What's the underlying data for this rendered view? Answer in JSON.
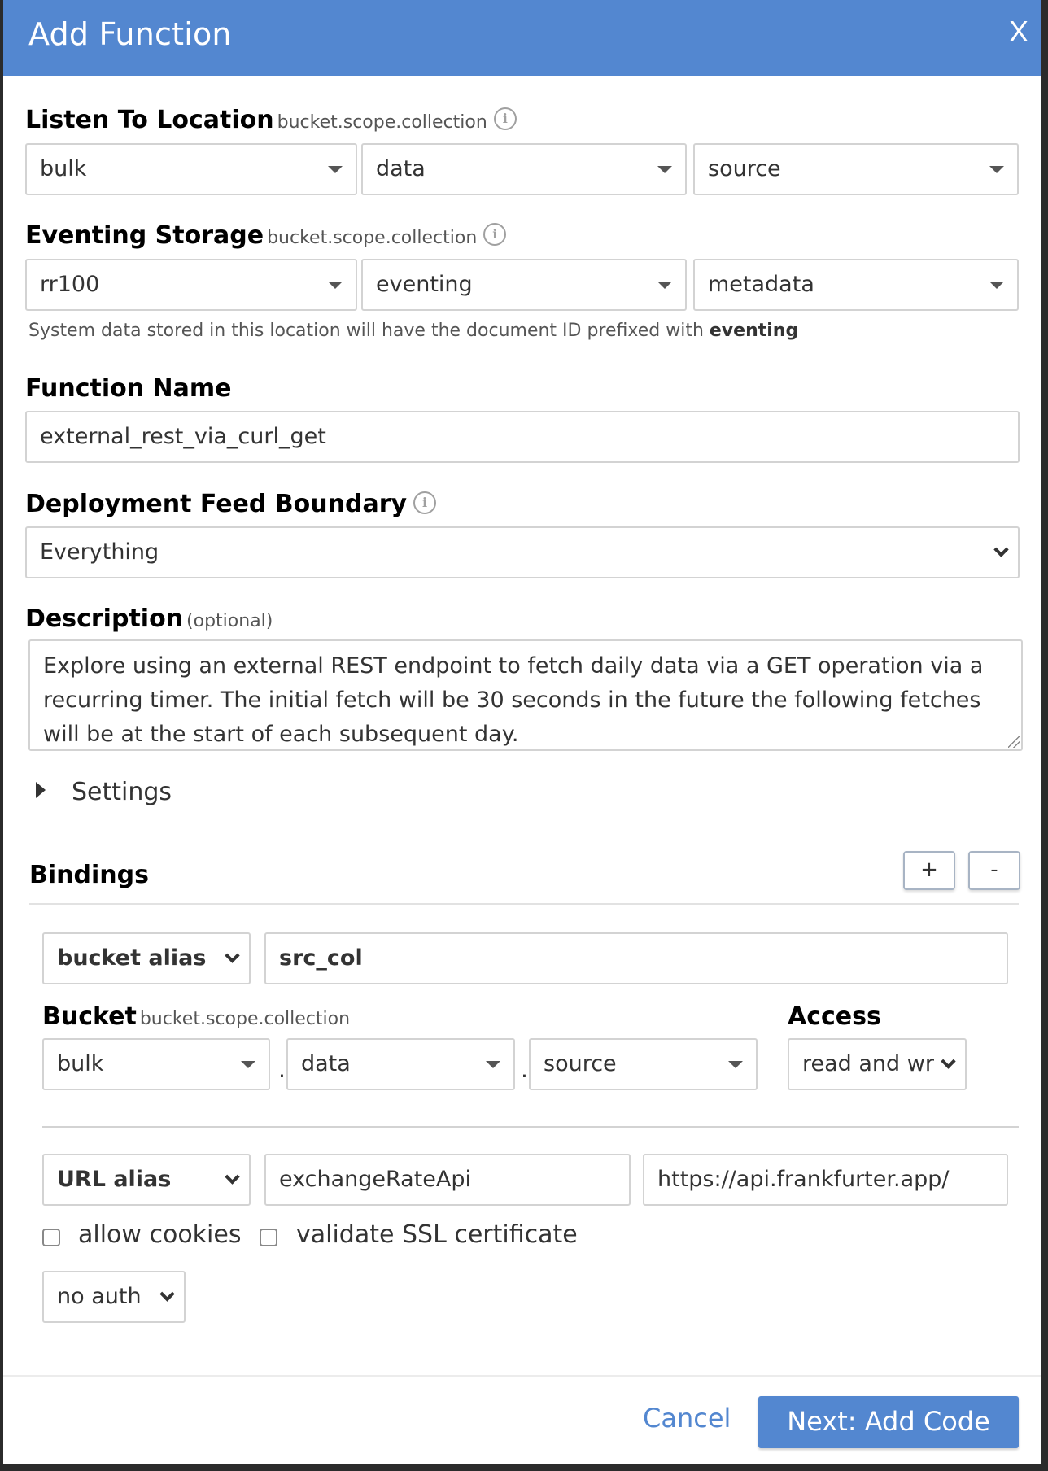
{
  "dialog": {
    "title": "Add Function",
    "close_label": "X"
  },
  "listen_to": {
    "label": "Listen To Location",
    "sublabel": "bucket.scope.collection",
    "bucket": "bulk",
    "scope": "data",
    "collection": "source"
  },
  "eventing_storage": {
    "label": "Eventing Storage",
    "sublabel": "bucket.scope.collection",
    "bucket": "rr100",
    "scope": "eventing",
    "collection": "metadata",
    "help_prefix": "System data stored in this location will have the document ID prefixed with",
    "help_bold": "eventing"
  },
  "function_name": {
    "label": "Function Name",
    "value": "external_rest_via_curl_get"
  },
  "feed_boundary": {
    "label": "Deployment Feed Boundary",
    "value": "Everything"
  },
  "description": {
    "label": "Description",
    "optional": "(optional)",
    "value": "Explore using an external REST endpoint to fetch daily data via a GET operation via a recurring timer.  The initial fetch will be 30 seconds in the future the following fetches will be at the start of each subsequent day."
  },
  "settings": {
    "label": "Settings"
  },
  "bindings": {
    "label": "Bindings",
    "add_label": "+",
    "remove_label": "-",
    "bucket_binding": {
      "type": "bucket alias",
      "alias": "src_col",
      "bucket_label": "Bucket",
      "bucket_sublabel": "bucket.scope.collection",
      "bucket": "bulk",
      "scope": "data",
      "collection": "source",
      "separator": ".",
      "access_label": "Access",
      "access": "read and wr"
    },
    "url_binding": {
      "type": "URL alias",
      "alias": "exchangeRateApi",
      "url": "https://api.frankfurter.app/",
      "allow_cookies_label": "allow cookies",
      "allow_cookies": false,
      "validate_ssl_label": "validate SSL certificate",
      "validate_ssl": false,
      "auth": "no auth"
    }
  },
  "footer": {
    "cancel_label": "Cancel",
    "next_label": "Next: Add Code"
  },
  "colors": {
    "primary": "#5387d0"
  }
}
